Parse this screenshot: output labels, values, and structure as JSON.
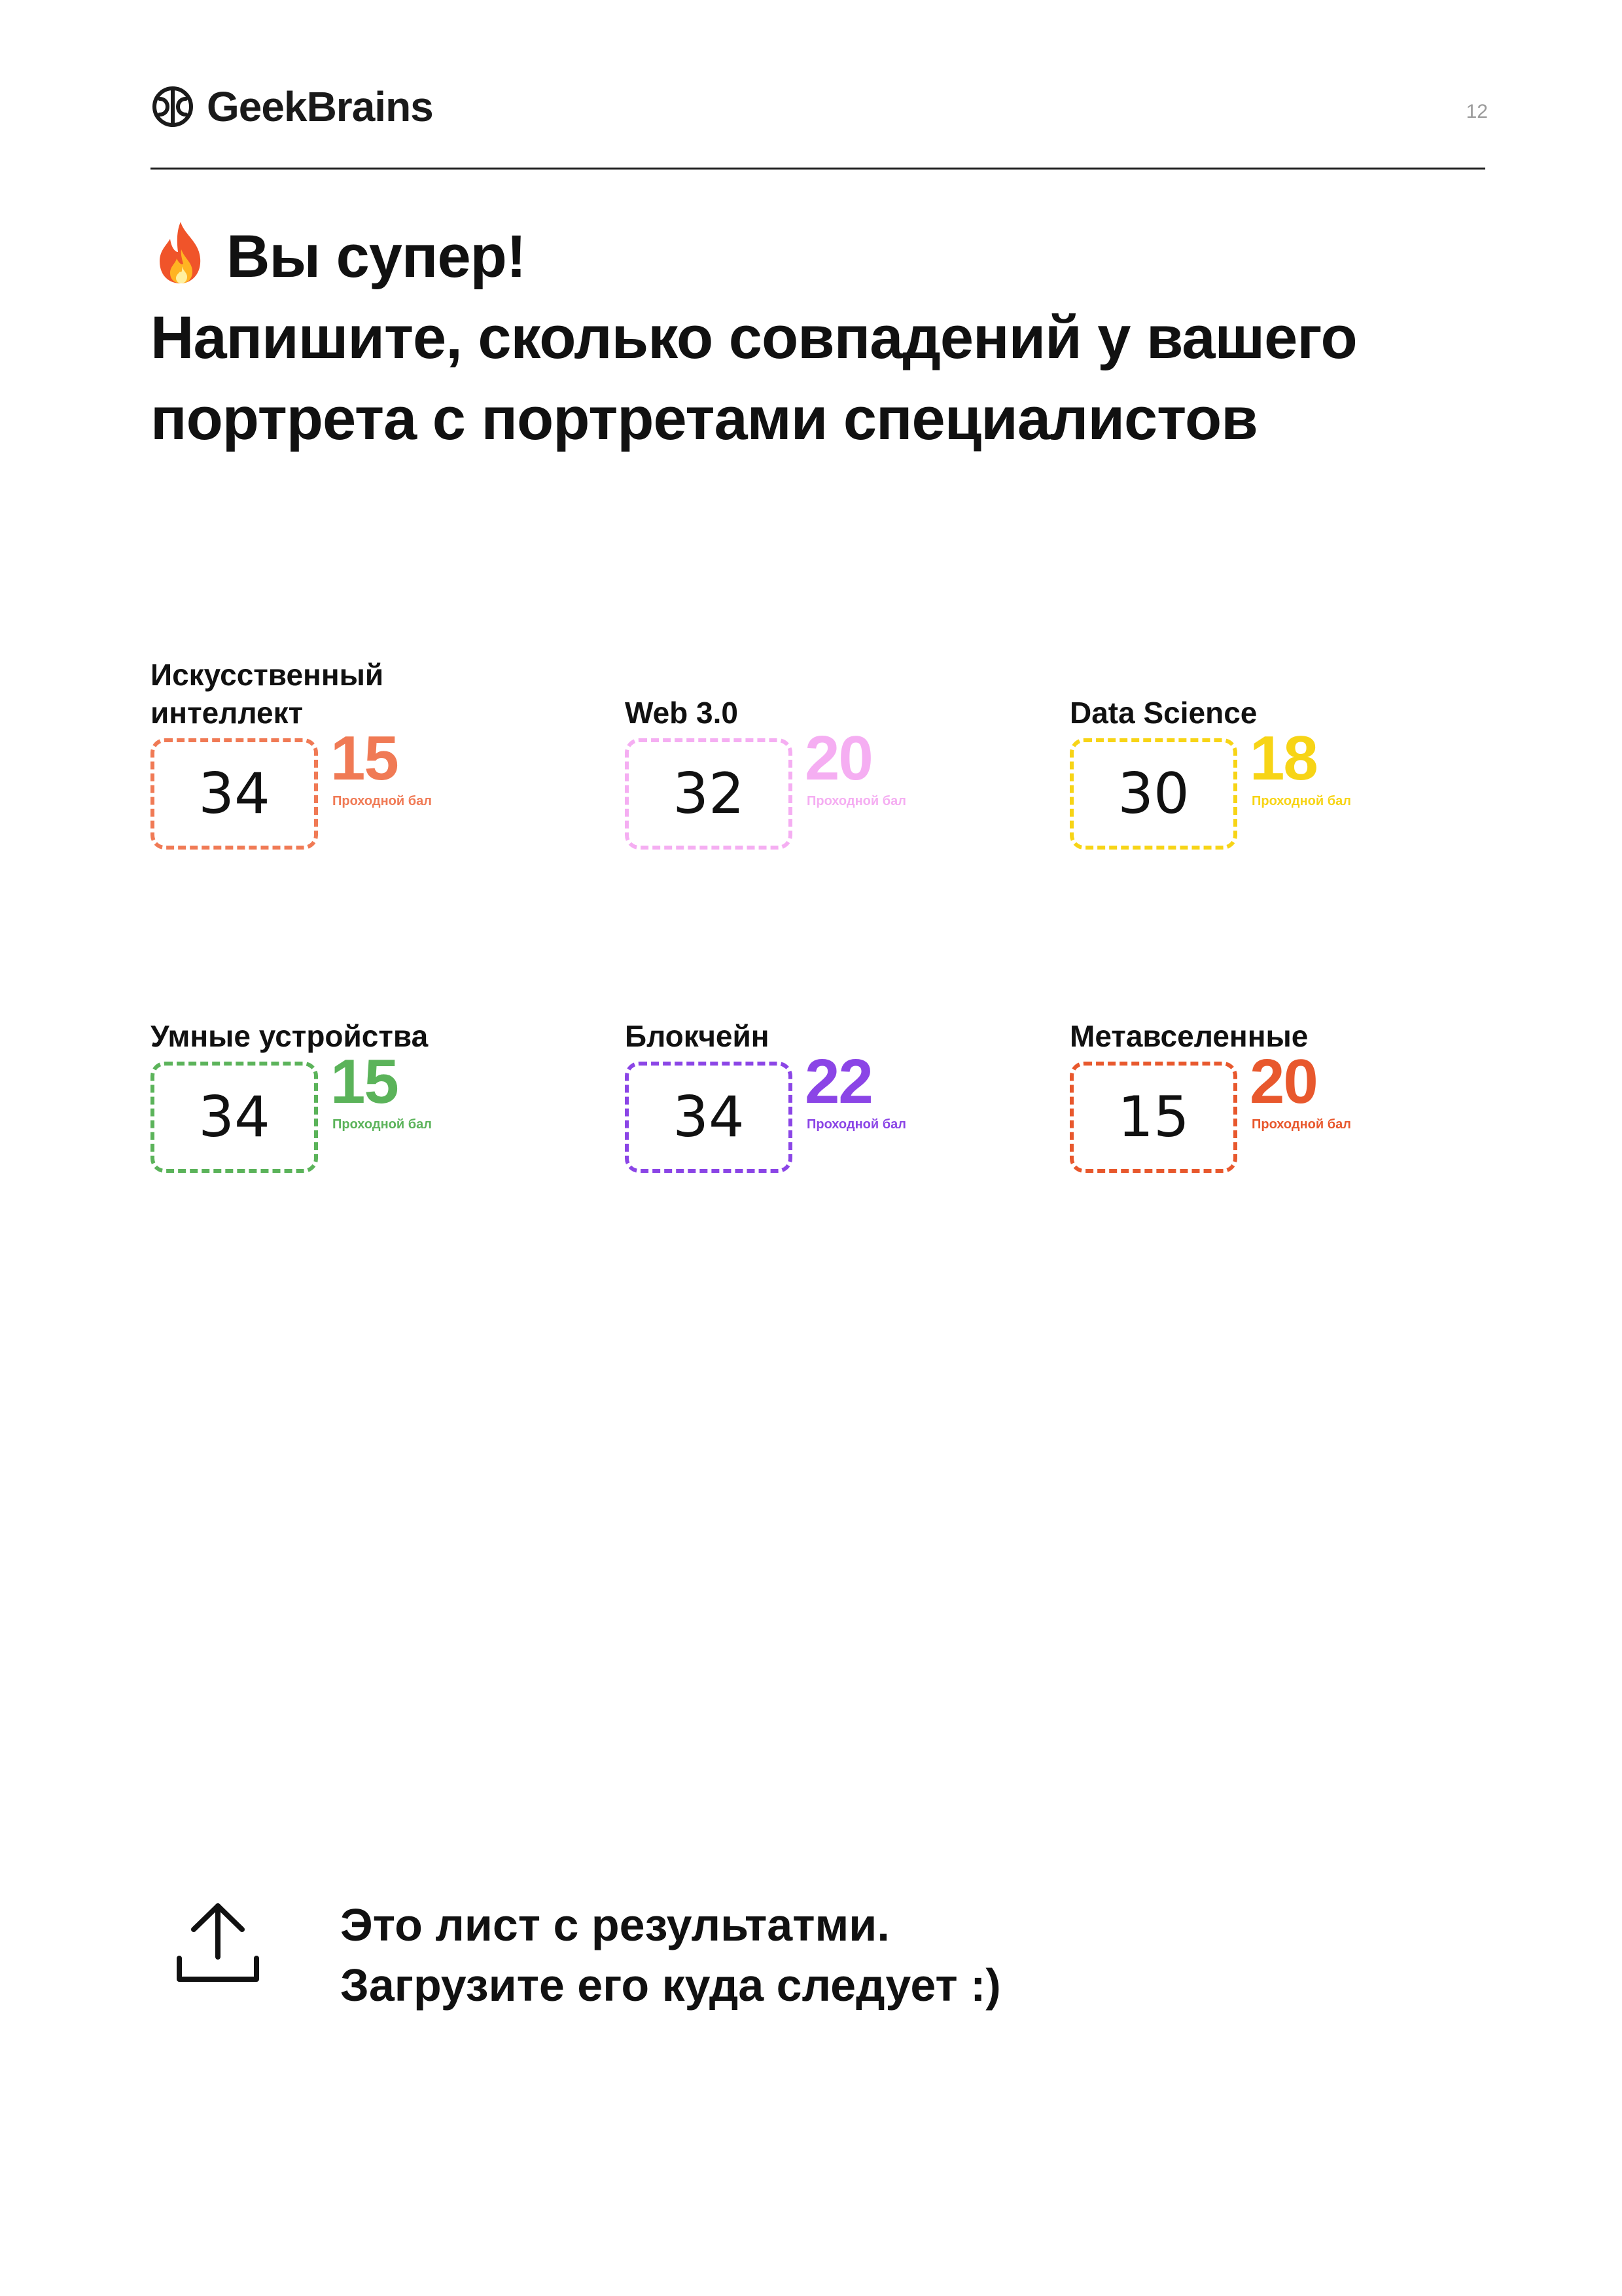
{
  "header": {
    "brand": "GeekBrains",
    "page_number": "12"
  },
  "title": {
    "line1": "Вы супер!",
    "line2": "Напишите, сколько совпадений у вашего",
    "line3": "портрета с портретами специалистов"
  },
  "cards": [
    {
      "label": "Искусственный интеллект",
      "value": "34",
      "pass_score": "15",
      "pass_label": "Проходной бал",
      "color": "#f07a55"
    },
    {
      "label": "Web 3.0",
      "value": "32",
      "pass_score": "20",
      "pass_label": "Проходной бал",
      "color": "#f5aef2"
    },
    {
      "label": "Data Science",
      "value": "30",
      "pass_score": "18",
      "pass_label": "Проходной бал",
      "color": "#f7d416"
    },
    {
      "label": "Умные устройства",
      "value": "34",
      "pass_score": "15",
      "pass_label": "Проходной бал",
      "color": "#5bb35a"
    },
    {
      "label": "Блокчейн",
      "value": "34",
      "pass_score": "22",
      "pass_label": "Проходной бал",
      "color": "#8b45e6"
    },
    {
      "label": "Метавселенные",
      "value": "15",
      "pass_score": "20",
      "pass_label": "Проходной бал",
      "color": "#e8582d"
    }
  ],
  "footer": {
    "line1": "Это лист с результатми.",
    "line2": "Загрузите его куда следует :)"
  }
}
